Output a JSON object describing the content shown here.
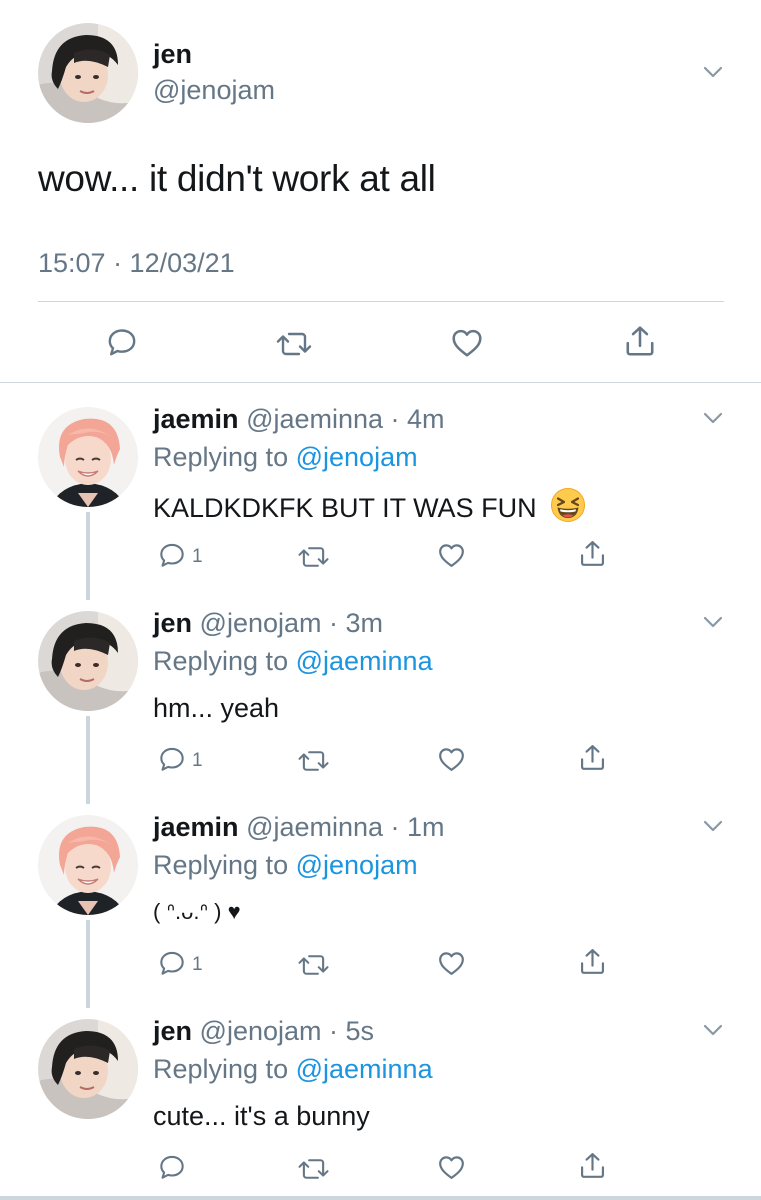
{
  "main_tweet": {
    "name": "jen",
    "handle": "@jenojam",
    "text": "wow... it didn't work at all",
    "timestamp": "15:07 · 12/03/21"
  },
  "replies": [
    {
      "name": "jaemin",
      "handle_time": "@jaeminna · 4m",
      "replying_prefix": "Replying to",
      "replying_to": "@jenojam",
      "text": "KALDKDKFK BUT IT WAS FUN",
      "emoji": "grinning-squinting-face",
      "reply_count": "1",
      "avatar": "pink-hair"
    },
    {
      "name": "jen",
      "handle_time": "@jenojam · 3m",
      "replying_prefix": "Replying to",
      "replying_to": "@jaeminna",
      "text": "hm... yeah",
      "reply_count": "1",
      "avatar": "dark-hair"
    },
    {
      "name": "jaemin",
      "handle_time": "@jaeminna · 1m",
      "replying_prefix": "Replying to",
      "replying_to": "@jenojam",
      "text": "( ᐢ.ᴗ.ᐢ ) ♥",
      "reply_count": "1",
      "avatar": "pink-hair"
    },
    {
      "name": "jen",
      "handle_time": "@jenojam · 5s",
      "replying_prefix": "Replying to",
      "replying_to": "@jaeminna",
      "text": "cute... it's a bunny",
      "reply_count": "",
      "avatar": "dark-hair"
    }
  ],
  "colors": {
    "text": "#14171a",
    "secondary": "#657786",
    "mention": "#1b95e0",
    "divider": "#ccd6dd"
  }
}
